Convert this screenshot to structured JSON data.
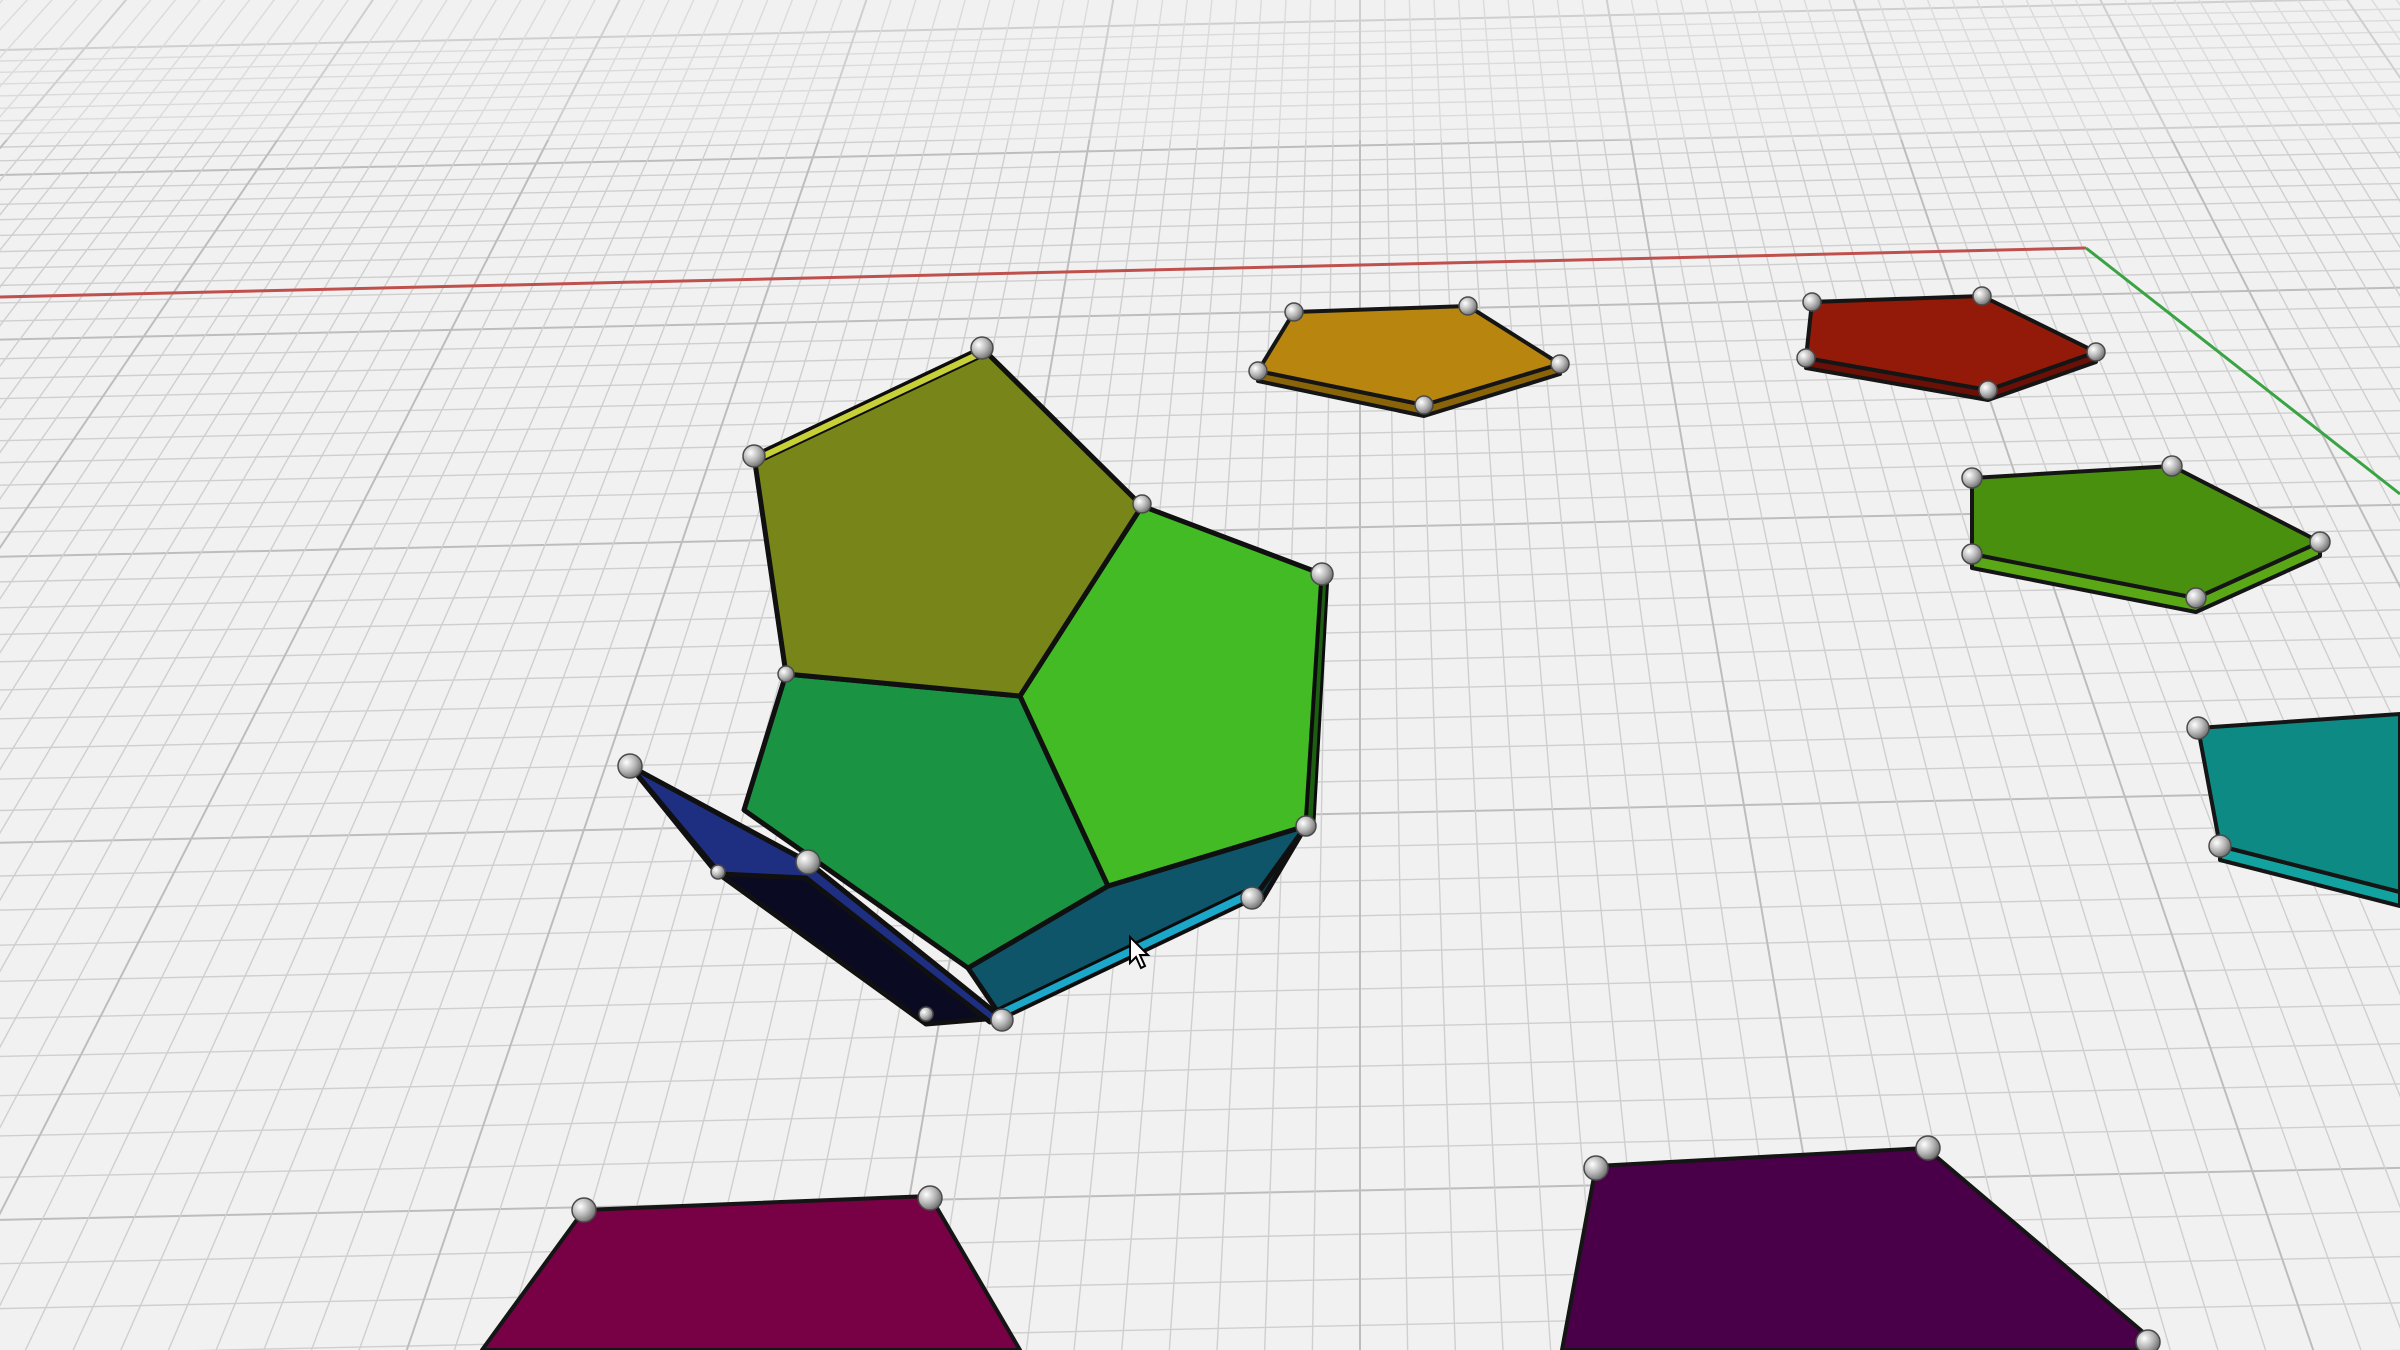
{
  "viewport": {
    "background": "#f1f1f1",
    "grid_color": "#cfcfcf",
    "x_axis_color": "#c0504d",
    "y_axis_color": "#3aa344"
  },
  "folded_shape": {
    "faces": [
      {
        "name": "olive-face",
        "color": "#788518"
      },
      {
        "name": "lime-face",
        "color": "#42bb24"
      },
      {
        "name": "green-face",
        "color": "#1a9442"
      },
      {
        "name": "navy-face",
        "color": "#1e2f82"
      },
      {
        "name": "teal-face",
        "color": "#0e556a"
      }
    ]
  },
  "flat_pentagons": [
    {
      "name": "orange-pentagon",
      "color": "#b8860f"
    },
    {
      "name": "red-pentagon",
      "color": "#931a08"
    },
    {
      "name": "green-pentagon",
      "color": "#4a900f"
    },
    {
      "name": "cyan-pentagon",
      "color": "#0e8a85"
    },
    {
      "name": "magenta-pentagon",
      "color": "#780045"
    },
    {
      "name": "purple-pentagon",
      "color": "#4a0048"
    }
  ],
  "cursor": {
    "icon": "mouse-pointer-icon"
  }
}
